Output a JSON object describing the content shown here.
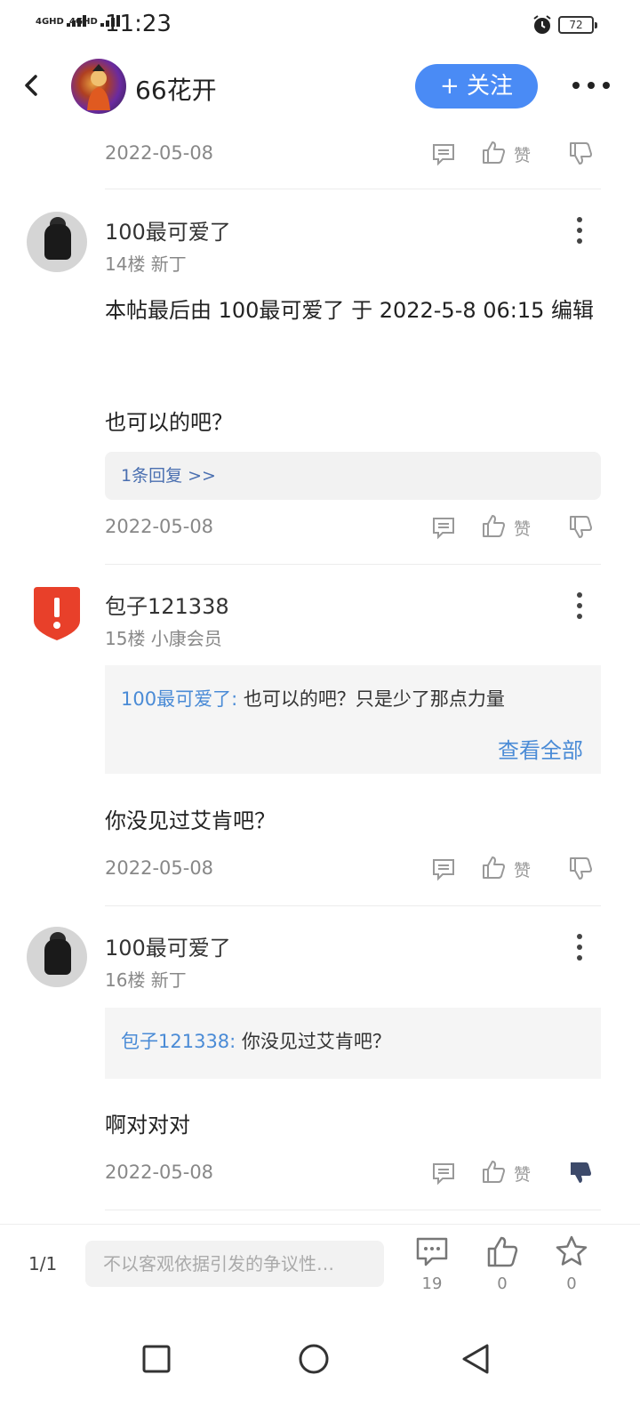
{
  "status": {
    "signal1": "4GHD",
    "signal2": "4GHD",
    "time": "11:23",
    "battery": "72"
  },
  "header": {
    "name": "66花开",
    "follow_label": "+ 关注"
  },
  "top_meta": {
    "date": "2022-05-08",
    "like_label": "赞"
  },
  "posts": [
    {
      "name": "100最可爱了",
      "sub": "14楼 新丁",
      "text1": "本帖最后由 100最可爱了 于 2022-5-8 06:15 编辑",
      "text2": "也可以的吧？",
      "reply_link": "1条回复 >>",
      "date": "2022-05-08",
      "like_label": "赞"
    },
    {
      "name": "包子121338",
      "sub": "15楼 小康会员",
      "quote_author": "100最可爱了:",
      "quote_text": " 也可以的吧？只是少了那点力量",
      "quote_more": "查看全部",
      "text": "你没见过艾肯吧？",
      "date": "2022-05-08",
      "like_label": "赞"
    },
    {
      "name": "100最可爱了",
      "sub": "16楼 新丁",
      "quote_author": "包子121338:",
      "quote_text": " 你没见过艾肯吧？",
      "text": "啊对对对",
      "date": "2022-05-08",
      "like_label": "赞"
    }
  ],
  "bottom_bar": {
    "page": "1/1",
    "input_placeholder": "不以客观依据引发的争议性…",
    "comment_count": "19",
    "like_count": "0",
    "star_count": "0"
  },
  "colors": {
    "accent": "#4a8bf5",
    "link": "#4a8bd6",
    "dislike_active": "#3d4a6a",
    "alert": "#e8402a"
  },
  "icons": [
    "back-icon",
    "more-icon",
    "comment-icon",
    "like-icon",
    "dislike-icon",
    "kebab-icon",
    "alarm-icon",
    "star-icon",
    "square-icon",
    "circle-icon",
    "triangle-back-icon"
  ]
}
